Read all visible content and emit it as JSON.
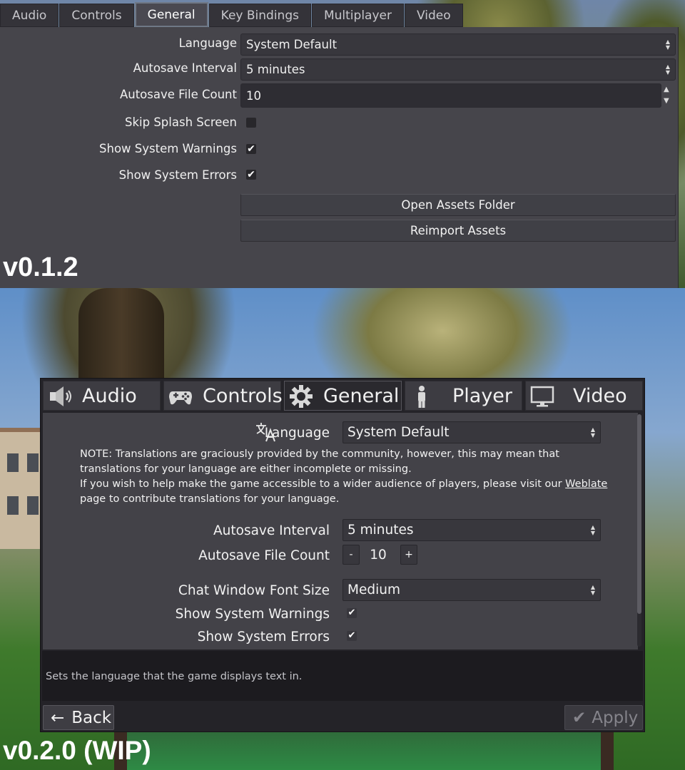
{
  "old_version": {
    "tabs": [
      {
        "label": "Audio",
        "active": false
      },
      {
        "label": "Controls",
        "active": false
      },
      {
        "label": "General",
        "active": true
      },
      {
        "label": "Key Bindings",
        "active": false
      },
      {
        "label": "Multiplayer",
        "active": false
      },
      {
        "label": "Video",
        "active": false
      }
    ],
    "language": {
      "label": "Language",
      "value": "System Default"
    },
    "autosave_interval": {
      "label": "Autosave Interval",
      "value": "5 minutes"
    },
    "autosave_file_count": {
      "label": "Autosave File Count",
      "value": "10"
    },
    "skip_splash": {
      "label": "Skip Splash Screen",
      "checked": false
    },
    "show_warnings": {
      "label": "Show System Warnings",
      "checked": true
    },
    "show_errors": {
      "label": "Show System Errors",
      "checked": true
    },
    "open_assets_label": "Open Assets Folder",
    "reimport_assets_label": "Reimport Assets",
    "version_label": "v0.1.2",
    "check_glyph": "✔",
    "updown_up": "▲",
    "updown_down": "▼"
  },
  "new_version": {
    "tabs": [
      {
        "label": "Audio",
        "icon": "speaker-icon",
        "active": false
      },
      {
        "label": "Controls",
        "icon": "gamepad-icon",
        "active": false
      },
      {
        "label": "General",
        "icon": "gear-icon",
        "active": true
      },
      {
        "label": "Player",
        "icon": "person-icon",
        "active": false
      },
      {
        "label": "Video",
        "icon": "monitor-icon",
        "active": false
      }
    ],
    "language": {
      "label": "Language",
      "value": "System Default"
    },
    "note": {
      "line1": "NOTE: Translations are graciously provided by the community, however, this may mean that translations for your language are either incomplete or missing.",
      "line2_before": "If you wish to help make the game accessible to a wider audience of players, please visit our ",
      "link": "Weblate",
      "line2_after": " page to contribute translations for your language."
    },
    "autosave_interval": {
      "label": "Autosave Interval",
      "value": "5 minutes"
    },
    "autosave_file_count": {
      "label": "Autosave File Count",
      "value": "10",
      "minus": "-",
      "plus": "+"
    },
    "chat_font_size": {
      "label": "Chat Window Font Size",
      "value": "Medium"
    },
    "show_warnings": {
      "label": "Show System Warnings",
      "checked": true
    },
    "show_errors": {
      "label": "Show System Errors",
      "checked": true
    },
    "help_text": "Sets the language that the game displays text in.",
    "back_label": "Back",
    "apply_label": "Apply",
    "version_label": "v0.2.0 (WIP)",
    "check_glyph": "✔",
    "updown_up": "▲",
    "updown_down": "▼",
    "back_glyph": "←",
    "apply_glyph": "✔"
  },
  "colors": {
    "old_panel_bg": "#46454b",
    "new_panel_bg": "#434248",
    "tab_active_border": "#6f7886",
    "apply_disabled_text": "#85848b"
  }
}
